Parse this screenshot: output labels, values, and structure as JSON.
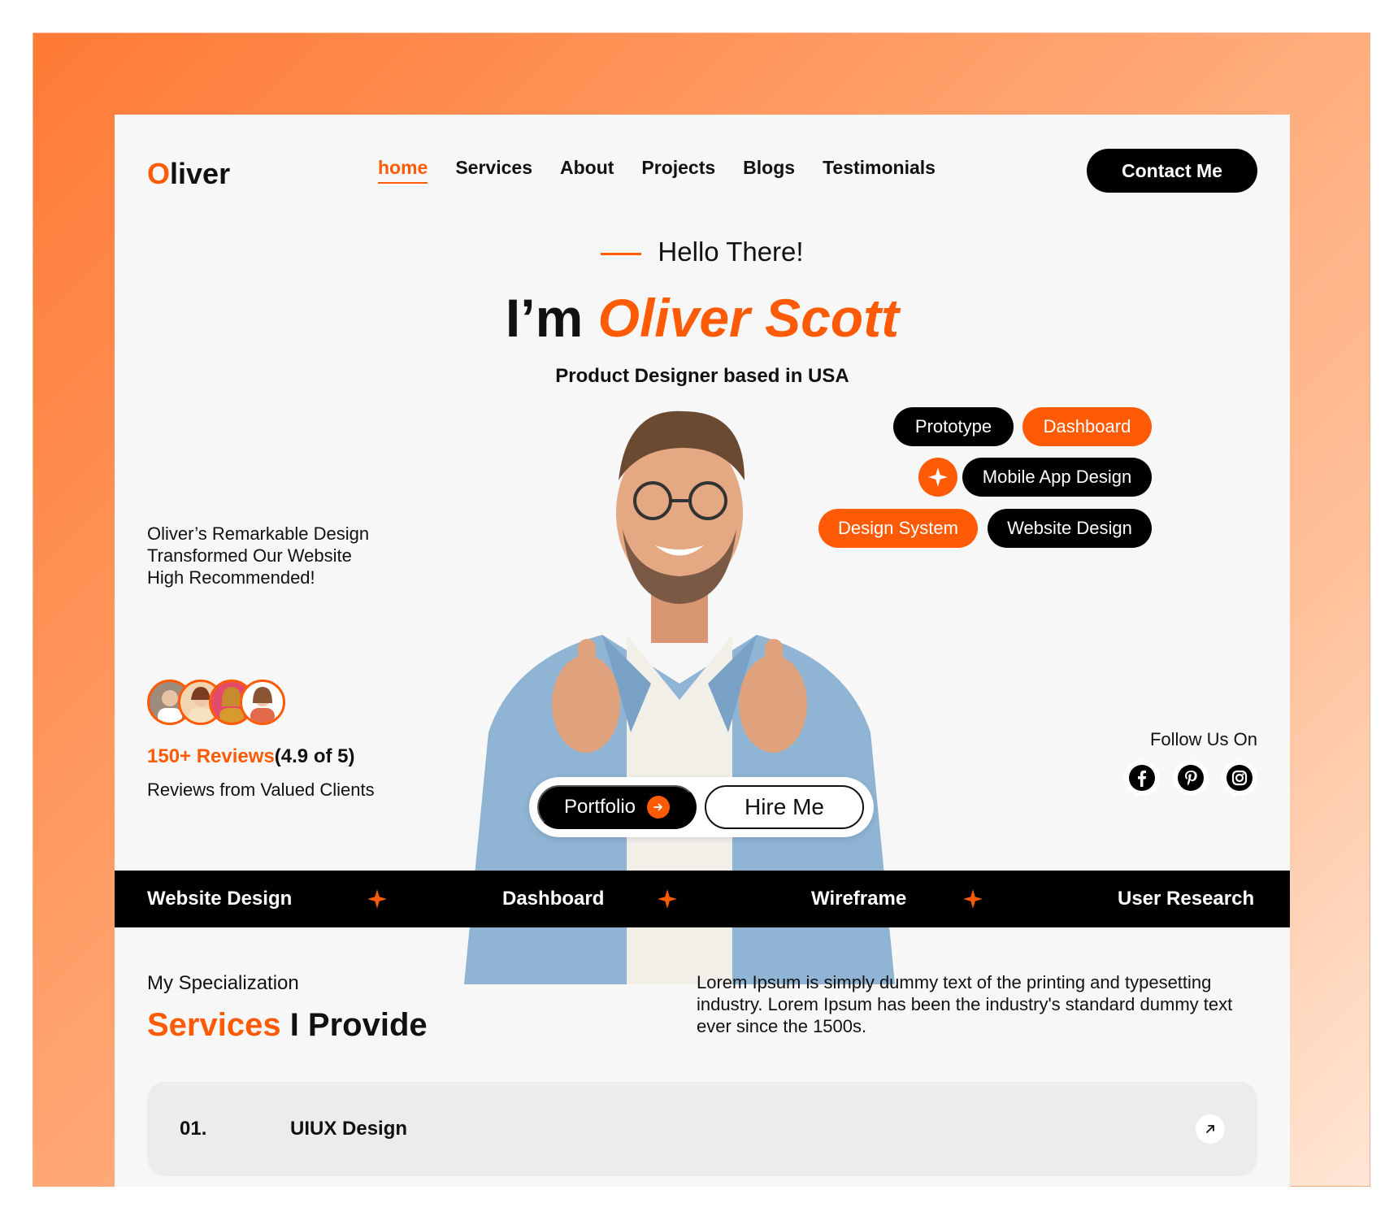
{
  "brand": {
    "logo_first": "O",
    "logo_rest": "liver",
    "accent": "#ff5a05"
  },
  "nav": {
    "items": [
      {
        "label": "home",
        "active": true
      },
      {
        "label": "Services"
      },
      {
        "label": "About"
      },
      {
        "label": "Projects"
      },
      {
        "label": "Blogs"
      },
      {
        "label": "Testimonials"
      }
    ],
    "contact_label": "Contact  Me"
  },
  "hero": {
    "greeting": "Hello There!",
    "title_prefix": "I’m ",
    "title_name": "Oliver Scott",
    "subtitle": "Product Designer based in USA"
  },
  "testimonial": {
    "line1": "Oliver’s Remarkable Design",
    "line2": "Transformed Our Website",
    "line3": "High Recommended!"
  },
  "reviews": {
    "count": "150+ Reviews",
    "score": "(4.9 of 5)",
    "caption": "Reviews  from Valued Clients"
  },
  "tags": {
    "prototype": "Prototype",
    "dashboard": "Dashboard",
    "mobile_app": "Mobile App Design",
    "design_system": "Design System",
    "website_design": "Website Design"
  },
  "follow": {
    "label": "Follow Us On",
    "icons": [
      "facebook-icon",
      "pinterest-icon",
      "instagram-icon"
    ]
  },
  "cta": {
    "portfolio": "Portfolio",
    "hire": "Hire Me"
  },
  "band": {
    "items": [
      "Website Design",
      "Dashboard",
      "Wireframe",
      "User Research"
    ]
  },
  "services": {
    "label": "My Specialization",
    "title_accent": "Services",
    "title_rest": " I Provide",
    "description": "Lorem Ipsum is simply dummy text of the printing and typesetting industry. Lorem Ipsum has been the industry's standard dummy text ever since the 1500s.",
    "items": [
      {
        "num": "01.",
        "name": "UIUX Design"
      }
    ]
  }
}
